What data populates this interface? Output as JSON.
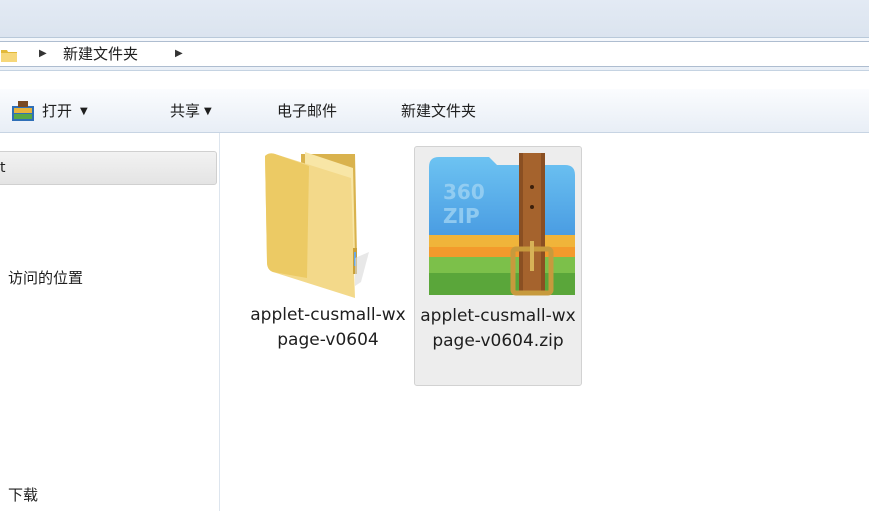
{
  "address": {
    "crumb": "新建文件夹"
  },
  "toolbar": {
    "open_label": "打开",
    "share_label": "共享",
    "email_label": "电子邮件",
    "new_folder_label": "新建文件夹",
    "dropdown_glyph": "▼"
  },
  "sidebar": {
    "header_text": "t",
    "recent_places": "访问的位置",
    "downloads": "下载"
  },
  "files": [
    {
      "name": "applet-cusmall-wxpage-v0604",
      "icon": "folder-icon"
    },
    {
      "name": "applet-cusmall-wxpage-v0604.zip",
      "icon": "zip-archive-icon",
      "selected": true
    }
  ],
  "zip_icon_brand": "360 ZIP",
  "colors": {
    "accent": "#3d8fe0",
    "selection": "#ededed",
    "folder": "#f2d57a",
    "belt": "#8a4f22"
  }
}
